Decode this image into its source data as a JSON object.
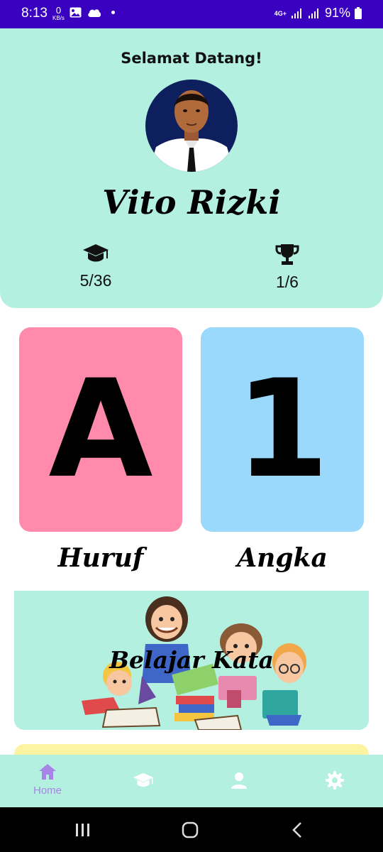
{
  "status_bar": {
    "time": "8:13",
    "net_speed_value": "0",
    "net_speed_unit": "KB/s",
    "network_type": "4G+",
    "battery_percent": "91%"
  },
  "header": {
    "welcome": "Selamat Datang!",
    "user_name": "Vito Rizki",
    "stats": {
      "lessons": "5/36",
      "trophies": "1/6"
    }
  },
  "cards": [
    {
      "glyph": "A",
      "label": "Huruf",
      "color": "#ff8aab"
    },
    {
      "glyph": "1",
      "label": "Angka",
      "color": "#9ad8fc"
    }
  ],
  "banner": {
    "title": "Belajar Kata"
  },
  "bottom_nav": {
    "items": [
      {
        "icon": "home-icon",
        "label": "Home",
        "active": true
      },
      {
        "icon": "graduation-cap-icon",
        "label": "",
        "active": false
      },
      {
        "icon": "person-icon",
        "label": "",
        "active": false
      },
      {
        "icon": "gear-icon",
        "label": "",
        "active": false
      }
    ]
  },
  "colors": {
    "status_bar": "#3a00c0",
    "header_bg": "#b3f0e0",
    "accent": "#a884e8",
    "nav_icon_inactive": "#ffffff"
  }
}
